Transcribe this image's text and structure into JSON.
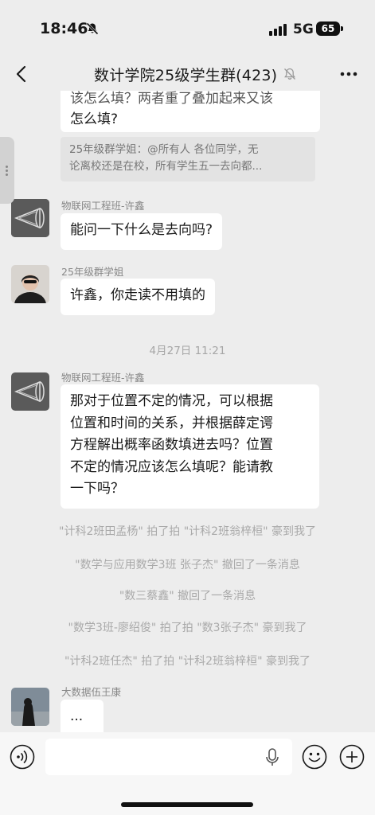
{
  "status_bar": {
    "time": "18:46",
    "network": "5G",
    "battery": "65"
  },
  "header": {
    "title": "数计学院25级学生群(423)"
  },
  "messages": {
    "top_bubble": {
      "line1": "该怎么填？两者重了叠加起来又该",
      "line2": "怎么填?"
    },
    "quote": {
      "line1": "25年级群学姐：@所有人 各位同学，无",
      "line2": "论离校还是在校，所有学生五一去向都..."
    },
    "m1": {
      "sender": "物联网工程班-许鑫",
      "text": "能问一下什么是去向吗?"
    },
    "m2": {
      "sender": "25年级群学姐",
      "text": "许鑫，你走读不用填的"
    },
    "timestamp": "4月27日 11:21",
    "m3": {
      "sender": "物联网工程班-许鑫",
      "lines": [
        "那对于位置不定的情况，可以根据",
        "位置和时间的关系，并根据薛定谔",
        "方程解出概率函数填进去吗？位置",
        "不定的情况应该怎么填呢？能请教",
        "一下吗？"
      ]
    },
    "system": [
      "\"计科2班田孟杨\" 拍了拍 \"计科2班翁梓桓\" 豪到我了",
      "\"数学与应用数学3班 张子杰\" 撤回了一条消息",
      "\"数三蔡鑫\" 撤回了一条消息",
      "\"数学3班-廖绍俊\" 拍了拍 \"数3张子杰\" 豪到我了",
      "\"计科2班任杰\" 拍了拍 \"计科2班翁梓桓\" 豪到我了"
    ],
    "m4": {
      "sender": "大数据伍王康",
      "text": "..."
    }
  },
  "input": {
    "value": "",
    "placeholder": ""
  }
}
